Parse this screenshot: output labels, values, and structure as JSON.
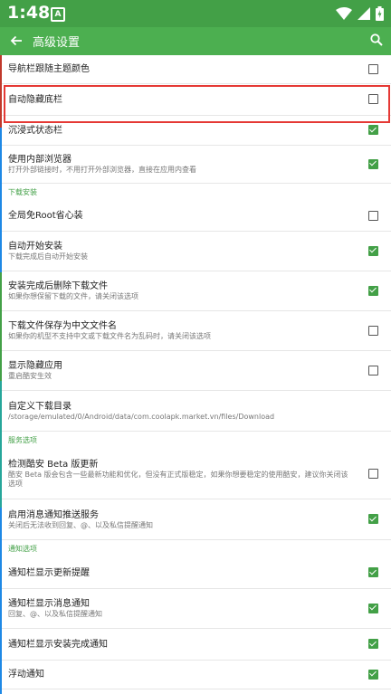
{
  "status_bar": {
    "time": "1:48",
    "app_icon": "A"
  },
  "app_bar": {
    "title": "高级设置"
  },
  "icons": {
    "back": "arrow-back-icon",
    "search": "search-icon",
    "wifi": "wifi-icon",
    "signal": "signal-icon",
    "battery": "battery-icon"
  },
  "colors": {
    "accent": "#4caf50",
    "highlight": "#e53935"
  },
  "items": [
    {
      "title": "导航栏跟随主题颜色",
      "checked": false
    },
    {
      "title": "自动隐藏底栏",
      "checked": false
    },
    {
      "title": "沉浸式状态栏",
      "checked": true
    },
    {
      "title": "使用内部浏览器",
      "subtitle": "打开外部链接时，不用打开外部浏览器，直接在应用内查看",
      "checked": true
    },
    {
      "section": "下载安装"
    },
    {
      "title": "全局免Root省心装",
      "checked": false
    },
    {
      "title": "自动开始安装",
      "subtitle": "下载完成后自动开始安装",
      "checked": true
    },
    {
      "title": "安装完成后删除下载文件",
      "subtitle": "如果你想保留下载的文件，请关闭该选项",
      "checked": true
    },
    {
      "title": "下载文件保存为中文文件名",
      "subtitle": "如果你的机型不支持中文或下载文件名为乱码时，请关闭该选项",
      "checked": false
    },
    {
      "title": "显示隐藏应用",
      "subtitle": "重启酷安生效",
      "checked": false
    },
    {
      "title": "自定义下载目录",
      "subtitle": "/storage/emulated/0/Android/data/com.coolapk.market.vn/files/Download"
    },
    {
      "section": "服务选项"
    },
    {
      "title": "检测酷安 Beta 版更新",
      "subtitle": "酷安 Beta 版会包含一些最新功能和优化，但没有正式版稳定，如果你想要稳定的使用酷安，建议你关闭该选项",
      "checked": false
    },
    {
      "title": "启用消息通知推送服务",
      "subtitle": "关闭后无法收到回复、@、以及私信提醒通知",
      "checked": true
    },
    {
      "section": "通知选项"
    },
    {
      "title": "通知栏显示更新提醒",
      "checked": true
    },
    {
      "title": "通知栏显示消息通知",
      "subtitle": "回复、@、以及私信提醒通知",
      "checked": true
    },
    {
      "title": "通知栏显示安装完成通知",
      "checked": true
    },
    {
      "title": "浮动通知",
      "checked": true
    }
  ]
}
